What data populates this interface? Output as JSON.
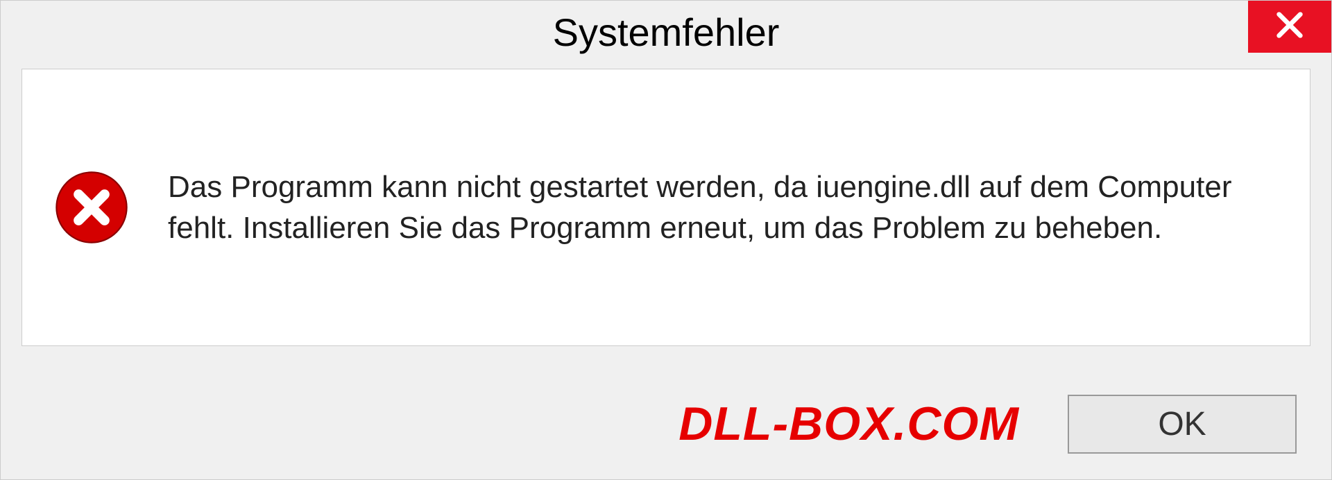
{
  "dialog": {
    "title": "Systemfehler",
    "message": "Das Programm kann nicht gestartet werden, da iuengine.dll auf dem Computer fehlt. Installieren Sie das Programm erneut, um das Problem zu beheben.",
    "ok_label": "OK"
  },
  "watermark": "DLL-BOX.COM",
  "colors": {
    "close_bg": "#e81123",
    "error_icon": "#d40000",
    "watermark": "#e60000"
  }
}
